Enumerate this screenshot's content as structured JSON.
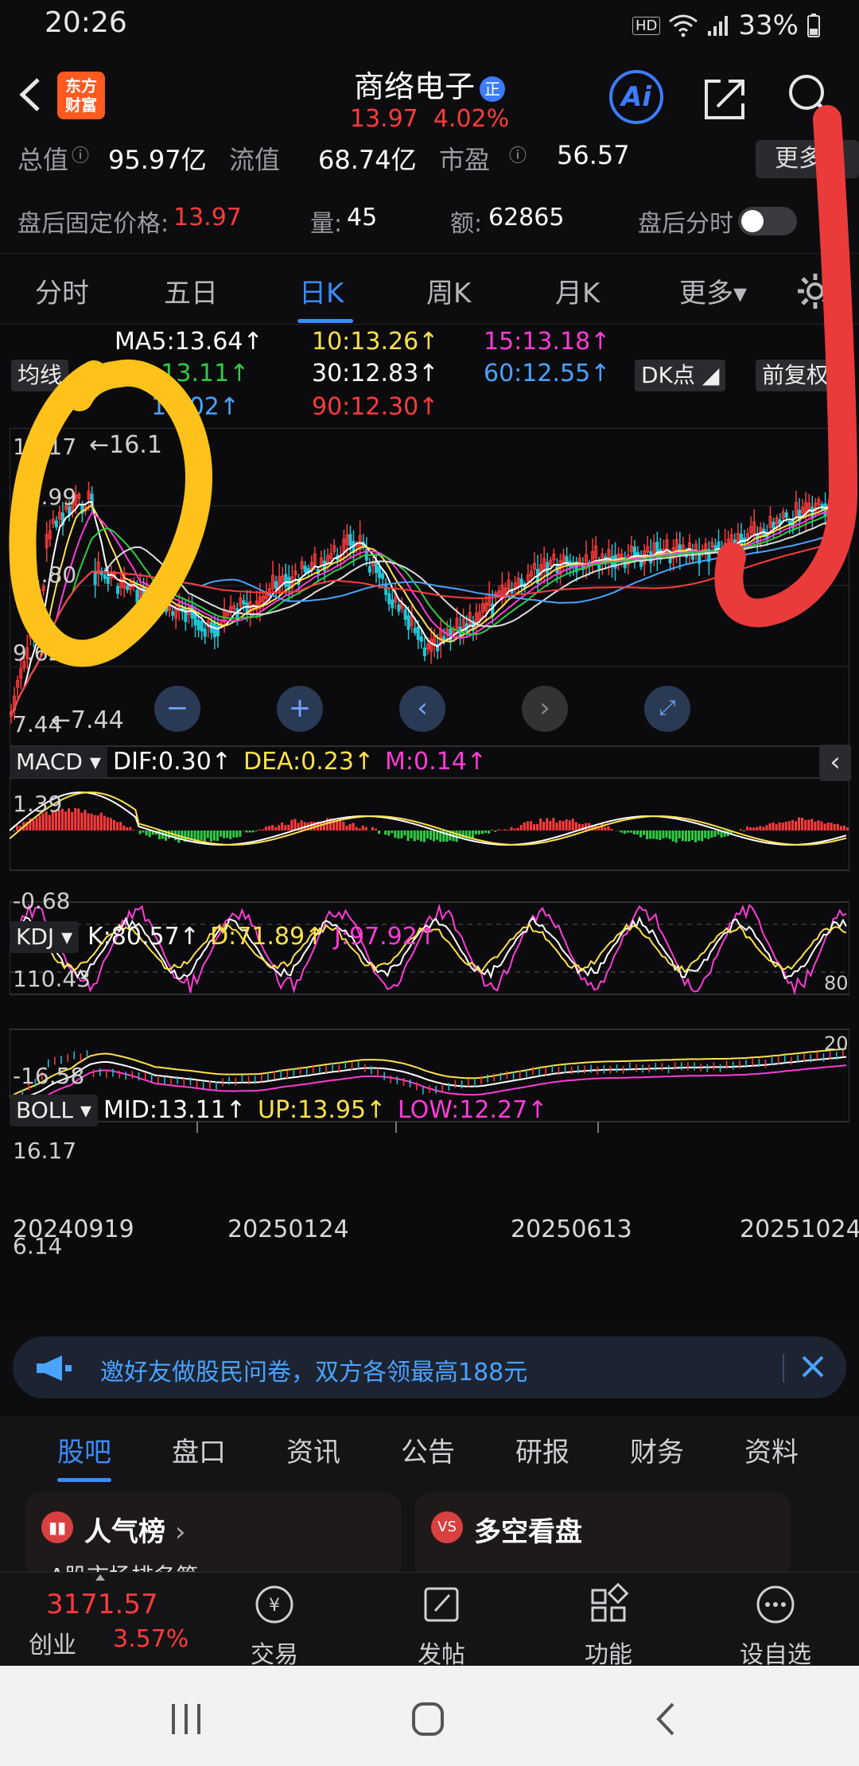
{
  "status": {
    "time": "20:26",
    "hd": "HD",
    "battery": "33%"
  },
  "header": {
    "logo_line1": "东方",
    "logo_line2": "财富",
    "name": "商络电子",
    "badge": "正",
    "price": "13.97",
    "change_pct": "4.02%",
    "ai_label": "Ai"
  },
  "info": {
    "total_label": "总值",
    "total_value": "95.97亿",
    "float_label": "流值",
    "float_value": "68.74亿",
    "pe_label": "市盈",
    "pe_value": "56.57",
    "more": "更多",
    "after_label": "盘后固定价格:",
    "after_price": "13.97",
    "vol_label": "量:",
    "vol_value": "45",
    "amt_label": "额:",
    "amt_value": "62865",
    "after_time_label": "盘后分时"
  },
  "ktabs": [
    {
      "label": "分时"
    },
    {
      "label": "五日"
    },
    {
      "label": "日K"
    },
    {
      "label": "周K"
    },
    {
      "label": "月K"
    },
    {
      "label": "更多▾"
    }
  ],
  "ma_legend": {
    "ma_label": "均线",
    "ma5": "MA5:13.64↑",
    "ma10": "10:13.26↑",
    "ma15": "15:13.18↑",
    "ma20": "20:13.11↑",
    "ma30": "30:12.83↑",
    "ma60": "60:12.55↑",
    "ma_extra": "12.02↑",
    "ma90": "90:12.30↑",
    "dk": "DK点",
    "fq": "前复权"
  },
  "main_axis": {
    "max": "16.17",
    "max_marker": "←16.1",
    "l2": "13.99",
    "l3": "11.80",
    "l4": "9.62",
    "min": "7.44",
    "min_marker": "←7.44"
  },
  "macd": {
    "name": "MACD",
    "dif": "DIF:0.30↑",
    "dea": "DEA:0.23↑",
    "m": "M:0.14↑",
    "top": "1.39",
    "bottom": "-0.68"
  },
  "kdj": {
    "name": "KDJ",
    "k": "K:80.57↑",
    "d": "D:71.89↑",
    "j": "J:97.92↑",
    "top": "110.43",
    "bottom": "-16.58",
    "r80": "80",
    "r20": "20"
  },
  "boll": {
    "name": "BOLL",
    "mid": "MID:13.11↑",
    "up": "UP:13.95↑",
    "low": "LOW:12.27↑",
    "top": "16.17",
    "bottom": "6.14"
  },
  "dates": [
    "20240919",
    "20250124",
    "20250613",
    "20251024"
  ],
  "banner": {
    "text": "邀好友做股民问卷，双方各领最高188元"
  },
  "section_tabs": [
    {
      "label": "股吧"
    },
    {
      "label": "盘口"
    },
    {
      "label": "资讯"
    },
    {
      "label": "公告"
    },
    {
      "label": "研报"
    },
    {
      "label": "财务"
    },
    {
      "label": "资料"
    }
  ],
  "cards": {
    "c1_title": "人气榜",
    "c1_sub": "A股市场排名第",
    "c2_title": "多空看盘"
  },
  "bottomnav": {
    "index_value": "3171.57",
    "index_name": "创业",
    "index_pct": "3.57%",
    "trade": "交易",
    "post": "发帖",
    "func": "功能",
    "watch": "设自选"
  },
  "colors": {
    "up": "#ff3b3b",
    "down": "#2fcb43",
    "accent": "#3d8bff",
    "yellow": "#ffe14a",
    "magenta": "#ff3bd7"
  }
}
